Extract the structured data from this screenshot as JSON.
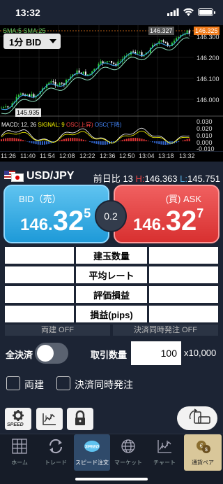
{
  "status_bar": {
    "time": "13:32"
  },
  "chart": {
    "period_label": "1分 BID",
    "ma_legend": "SMA:5 SMA:25",
    "price_axis": [
      "146.300",
      "146.200",
      "146.100",
      "146.000"
    ],
    "high_marker": "146.327",
    "current_marker": "146.325",
    "low_marker": "145.935",
    "macd_legend": {
      "macd": "MACD: 12, 26",
      "signal": "SIGNAL: 9",
      "osc_up": "OSC(上昇)",
      "osc_down": "OSC(下降)"
    },
    "macd_axis": [
      "0.030",
      "0.020",
      "0.010",
      "0.000",
      "-0.010"
    ],
    "time_axis": [
      "11:26",
      "11:40",
      "11:54",
      "12:08",
      "12:22",
      "12:36",
      "12:50",
      "13:04",
      "13:18",
      "13:32"
    ]
  },
  "pair": {
    "name": "USD/JPY",
    "prev_day_label": "前日比",
    "prev_day_value": "13",
    "high_label": "H:",
    "high_value": "146.363",
    "low_label": "L:",
    "low_value": "145.751"
  },
  "bid": {
    "label": "BID（売）",
    "main": "146.",
    "pips": "32",
    "sub": "5"
  },
  "ask": {
    "label": "(買) ASK",
    "main": "146.",
    "pips": "32",
    "sub": "7"
  },
  "spread": "0.2",
  "info_rows": [
    "建玉数量",
    "平均レート",
    "評価損益",
    "損益(pips)"
  ],
  "toggles": {
    "hedge": "両建 OFF",
    "simul": "決済同時発注 OFF"
  },
  "order": {
    "close_all_label": "全決済",
    "qty_label": "取引数量",
    "qty_value": "100",
    "unit": "x10,000"
  },
  "checkboxes": {
    "hedge": "両建",
    "simul": "決済同時発注"
  },
  "tools": {
    "speed": "SPEED"
  },
  "tabs": [
    {
      "label": "ホーム",
      "icon": "grid-icon"
    },
    {
      "label": "トレード",
      "icon": "swap-icon"
    },
    {
      "label": "スピード注文",
      "icon": "speed-icon"
    },
    {
      "label": "マーケット",
      "icon": "globe-icon"
    },
    {
      "label": "チャート",
      "icon": "chart-icon"
    },
    {
      "label": "通貨ペア",
      "icon": "currency-pair-icon"
    }
  ],
  "colors": {
    "background": "#1c2434",
    "bid": "#1e9ad8",
    "ask": "#d83030",
    "candle_up": "#2ecc40",
    "candle_down": "#ffffff",
    "sma_short": "#3fa9f5",
    "sma_long": "#8fe0c0"
  }
}
